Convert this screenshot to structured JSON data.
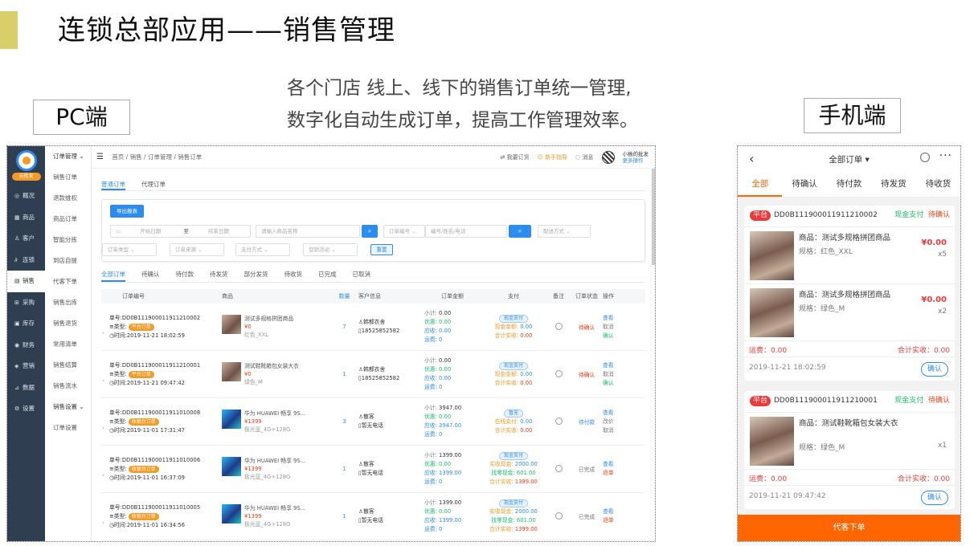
{
  "slide": {
    "title": "连锁总部应用——销售管理",
    "desc_line1": "各个门店 线上、线下的销售订单统一管理,",
    "desc_line2": "数字化自动生成订单，提高工作管理效率。",
    "pc_label": "PC端",
    "mobile_label": "手机端",
    "accent_color": "#d9cf6a"
  },
  "pc": {
    "brand": "云批发",
    "nav": [
      {
        "icon": "dashboard-icon",
        "label": "概况"
      },
      {
        "icon": "grid-icon",
        "label": "商品"
      },
      {
        "icon": "user-icon",
        "label": "客户"
      },
      {
        "icon": "link-icon",
        "label": "连锁"
      },
      {
        "icon": "document-icon",
        "label": "销售"
      },
      {
        "icon": "cart-icon",
        "label": "采购"
      },
      {
        "icon": "warehouse-icon",
        "label": "库存"
      },
      {
        "icon": "finance-icon",
        "label": "财务"
      },
      {
        "icon": "marketing-icon",
        "label": "营销"
      },
      {
        "icon": "chart-icon",
        "label": "数据"
      },
      {
        "icon": "gear-icon",
        "label": "设置"
      }
    ],
    "subnav": [
      "订单管理",
      "销售订单",
      "退款维权",
      "商品订单",
      "智能分拣",
      "到店自提",
      "代客下单",
      "销售出库",
      "销售退货",
      "常用清单",
      "销售结算",
      "销售流水",
      "销售设置",
      "订单设置"
    ],
    "breadcrumb": [
      "首页",
      "销售",
      "订单管理",
      "销售订单"
    ],
    "top": {
      "order_tip": "我要订货",
      "guide": "新手指导",
      "message": "消息",
      "user": "小杨的批发",
      "more": "更多操作"
    },
    "tabs": [
      "普通订单",
      "代理订单"
    ],
    "filter": {
      "export": "导出报表",
      "start_date": "开始日期",
      "to": "至",
      "end_date": "结束日期",
      "product": "请输入商品名称",
      "order_no": "订单编号",
      "keyword": "编号/姓名/电话",
      "delivery": "配送方式",
      "order_type": "订单类型",
      "order_source": "订单来源",
      "payment": "支付方式",
      "promotion": "促销活动",
      "reset": "重置"
    },
    "status_tabs": [
      "全部订单",
      "待确认",
      "待付款",
      "待发货",
      "部分发货",
      "待收货",
      "已完成",
      "已取消"
    ],
    "columns": [
      "订单编号",
      "商品",
      "数量",
      "客户信息",
      "订单金额",
      "支付",
      "备注",
      "订单状态",
      "操作"
    ],
    "orders": [
      {
        "no": "单号:DD0B111900011911210002",
        "type_label": "类型:",
        "type": "平台订单",
        "time": "时间:2019-11-21 18:02:59",
        "product": "测试多规格拼团商品",
        "price": "¥0",
        "spec": "红色_XXL",
        "qty": "7",
        "customer": "韩都衣舍",
        "phone": "18525852582",
        "subtotal": "0.00",
        "discount": "0.00",
        "receivable": "0.00",
        "freight": "0",
        "pay_tag": "现金支付",
        "pay1_label": "现金金额:",
        "pay1": "0.00",
        "pay2_label": "合计实收:",
        "pay2": "0.00",
        "state": "待确认",
        "ops": [
          "查看",
          "取消",
          "确认"
        ]
      },
      {
        "no": "单号:DD0B111900011911210001",
        "type_label": "类型:",
        "type": "平台订单",
        "time": "时间:2019-11-21 09:47:42",
        "product": "测试鞋靴箱包女装大衣",
        "price": "¥0",
        "spec": "绿色_M",
        "qty": "1",
        "customer": "韩都衣舍",
        "phone": "18525852582",
        "subtotal": "0.00",
        "discount": "0.00",
        "receivable": "0.00",
        "freight": "0",
        "pay_tag": "现金支付",
        "pay1_label": "现金金额:",
        "pay1": "0.00",
        "pay2_label": "合计实收:",
        "pay2": "0.00",
        "state": "待确认",
        "ops": [
          "查看",
          "取消",
          "确认"
        ]
      },
      {
        "no": "单号:DD0B111900011911010008",
        "type_label": "类型:",
        "type": "收银台订单",
        "time": "时间:2019-11-01 17:31:47",
        "product": "华为 HUAWEI 畅享 9S...",
        "price": "¥1399",
        "spec": "极光蓝_4G+128G",
        "qty": "3",
        "customer": "散客",
        "phone": "暂无电话",
        "subtotal": "3947.00",
        "discount": "0.00",
        "receivable": "3947.00",
        "freight": "0",
        "pay_tag": "暂无",
        "pay1_label": "在线支付:",
        "pay1": "0.00",
        "pay2_label": "合计实收:",
        "pay2": "0.00",
        "state": "待付款",
        "ops": [
          "查看",
          "改价",
          "取消"
        ]
      },
      {
        "no": "单号:DD0B111900011911010006",
        "type_label": "类型:",
        "type": "收银台订单",
        "time": "时间:2019-11-01 16:37:09",
        "product": "华为 HUAWEI 畅享 9S...",
        "price": "¥1399",
        "spec": "极光蓝_4G+128G",
        "qty": "1",
        "customer": "散客",
        "phone": "暂无电话",
        "subtotal": "1399.00",
        "discount": "0.00",
        "receivable": "1399.00",
        "freight": "0",
        "pay_tag": "现金支付",
        "pay1_label": "实收现金:",
        "pay1": "2000.00",
        "pay1b_label": "找零现金:",
        "pay1b": "601.00",
        "pay2_label": "合计实收:",
        "pay2": "1399.00",
        "state": "已完成",
        "ops": [
          "查看",
          "退单"
        ]
      },
      {
        "no": "单号:DD0B111900011911010005",
        "type_label": "类型:",
        "type": "收银台订单",
        "time": "时间:2019-11-01 16:34:56",
        "product": "华为 HUAWEI 畅享 9S...",
        "price": "¥1399",
        "spec": "极光蓝_4G+128G",
        "qty": "1",
        "customer": "散客",
        "phone": "暂无电话",
        "subtotal": "1399.00",
        "discount": "0.00",
        "receivable": "1399.00",
        "freight": "0",
        "pay_tag": "现金支付",
        "pay1_label": "实收现金:",
        "pay1": "2000.00",
        "pay1b_label": "找零现金:",
        "pay1b": "601.00",
        "pay2_label": "合计实收:",
        "pay2": "1399.00",
        "state": "已完成",
        "ops": [
          "查看",
          "退单"
        ]
      }
    ],
    "amount_labels": {
      "subtotal": "小计:",
      "discount": "优惠:",
      "receivable": "应收:",
      "freight": "运费:"
    }
  },
  "mobile": {
    "title": "全部订单",
    "tabs": [
      "全部",
      "待确认",
      "待付款",
      "待发货",
      "待收货"
    ],
    "orders": [
      {
        "platform": "平台",
        "no": "DD0B111900011911210002",
        "pay": "现金支付",
        "state": "待确认",
        "items": [
          {
            "name": "商品：测试多规格拼团商品",
            "spec": "规格：红色_XXL",
            "price": "¥0.00",
            "qty": "x5"
          },
          {
            "name": "商品：测试多规格拼团商品",
            "spec": "规格：绿色_M",
            "price": "¥0.00",
            "qty": "x2"
          }
        ],
        "freight": "运费：0.00",
        "total": "合计实收：0.00",
        "time": "2019-11-21 18:02:59",
        "confirm": "确认"
      },
      {
        "platform": "平台",
        "no": "DD0B111900011911210001",
        "pay": "现金支付",
        "state": "待确认",
        "items": [
          {
            "name": "商品：测试鞋靴箱包女装大衣",
            "spec": "规格：绿色_M",
            "price": "¥0.00",
            "qty": "x1"
          }
        ],
        "freight": "运费：0.00",
        "total": "合计实收：0.00",
        "time": "2019-11-21 09:47:42",
        "confirm": "确认"
      }
    ],
    "bottom_button": "代客下单",
    "accent_color": "#ff6600"
  }
}
